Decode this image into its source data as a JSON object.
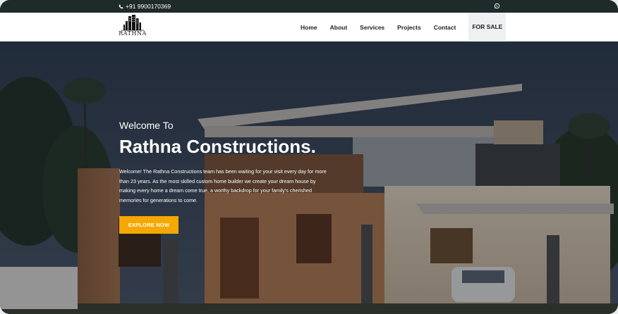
{
  "topbar": {
    "phone": "+91 9900170369",
    "whatsapp_icon": "whatsapp-icon",
    "phone_icon": "phone-icon"
  },
  "brand": {
    "logo_text": "RATHNA"
  },
  "nav": {
    "items": [
      "Home",
      "About",
      "Services",
      "Projects",
      "Contact",
      "FOR SALE"
    ]
  },
  "hero": {
    "welcome": "Welcome To",
    "title": "Rathna Constructions.",
    "description": "Welcome! The Rathna Constructions team has been waiting for your visit every day for more than 23 years. As the most skilled custom home builder we create your dream house by making every home a dream come true, a worthy backdrop for your family's cherished memories for generations to come.",
    "cta": "EXPLORE NOW"
  },
  "colors": {
    "topbar": "#1f2a2b",
    "accent": "#f5a800",
    "nav_bg": "#ffffff"
  }
}
